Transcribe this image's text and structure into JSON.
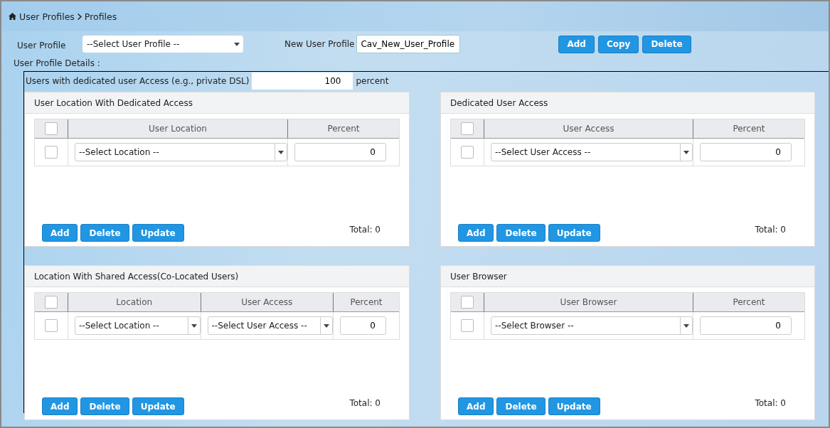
{
  "breadcrumb": [
    "User Profiles",
    "Profiles"
  ],
  "user_profile": {
    "label": "User Profile",
    "value": "--Select User Profile --"
  },
  "new_user_profile": {
    "label": "New User Profile",
    "value": "Cav_New_User_Profile"
  },
  "top_buttons": [
    "Add",
    "Copy",
    "Delete"
  ],
  "details_label": "User Profile Details :",
  "dedicated": {
    "label": "Users with dedicated user Access (e.g., private DSL)",
    "value": "100",
    "unit": "percent"
  },
  "panels": [
    {
      "title": "User Location With Dedicated Access",
      "select_all": {
        "checked": false
      },
      "columns": [
        "User Location",
        "Percent"
      ],
      "rows": [
        {
          "checked": false,
          "cells": [
            {
              "kind": "select",
              "value": "--Select Location --"
            },
            {
              "kind": "number",
              "value": "0"
            }
          ]
        }
      ],
      "buttons": [
        "Add",
        "Delete",
        "Update"
      ],
      "total": "Total: 0"
    },
    {
      "title": "Dedicated User Access",
      "select_all": {
        "checked": false
      },
      "columns": [
        "User Access",
        "Percent"
      ],
      "rows": [
        {
          "checked": false,
          "cells": [
            {
              "kind": "select",
              "value": "--Select User Access --"
            },
            {
              "kind": "number",
              "value": "0"
            }
          ]
        }
      ],
      "buttons": [
        "Add",
        "Delete",
        "Update"
      ],
      "total": "Total: 0"
    },
    {
      "title": "Location With Shared Access(Co-Located Users)",
      "select_all": {
        "checked": false
      },
      "columns": [
        "Location",
        "User Access",
        "Percent"
      ],
      "rows": [
        {
          "checked": false,
          "cells": [
            {
              "kind": "select",
              "value": "--Select Location --"
            },
            {
              "kind": "select",
              "value": "--Select User Access --"
            },
            {
              "kind": "number",
              "value": "0"
            }
          ]
        }
      ],
      "buttons": [
        "Add",
        "Delete",
        "Update"
      ],
      "total": "Total: 0"
    },
    {
      "title": "User Browser",
      "select_all": {
        "checked": false
      },
      "columns": [
        "User Browser",
        "Percent"
      ],
      "rows": [
        {
          "checked": false,
          "cells": [
            {
              "kind": "select",
              "value": "--Select Browser --"
            },
            {
              "kind": "number",
              "value": "0"
            }
          ]
        }
      ],
      "buttons": [
        "Add",
        "Delete",
        "Update"
      ],
      "total": "Total: 0"
    }
  ]
}
